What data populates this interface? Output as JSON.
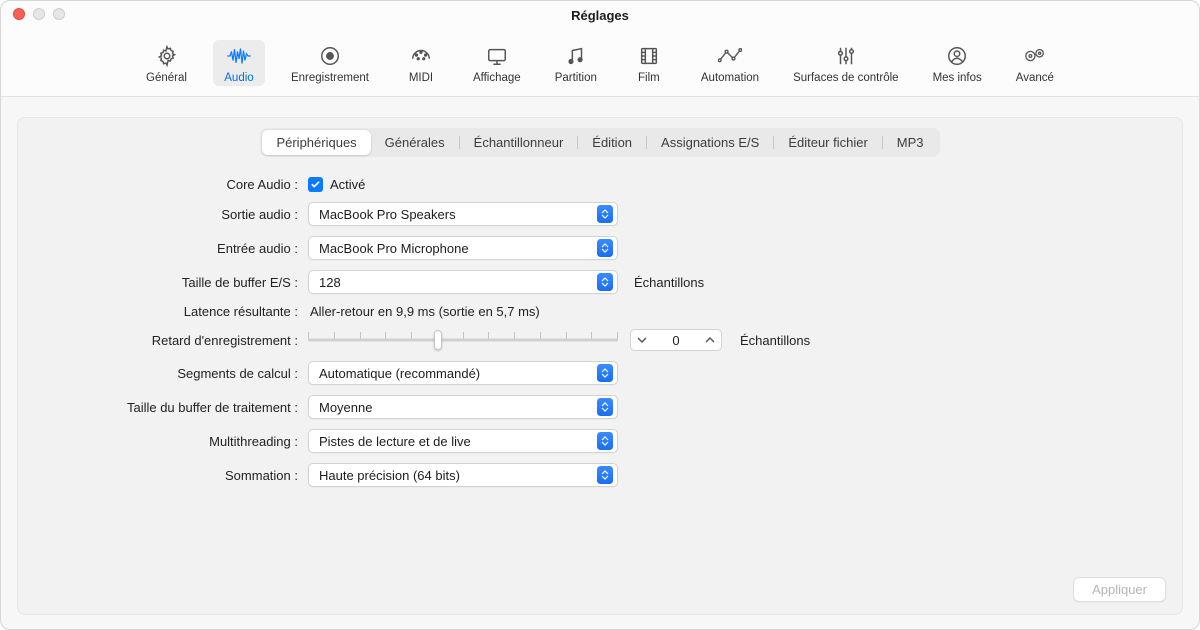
{
  "window": {
    "title": "Réglages"
  },
  "toolbar": {
    "items": [
      {
        "id": "general",
        "label": "Général"
      },
      {
        "id": "audio",
        "label": "Audio"
      },
      {
        "id": "recording",
        "label": "Enregistrement"
      },
      {
        "id": "midi",
        "label": "MIDI"
      },
      {
        "id": "display",
        "label": "Affichage"
      },
      {
        "id": "score",
        "label": "Partition"
      },
      {
        "id": "movie",
        "label": "Film"
      },
      {
        "id": "automation",
        "label": "Automation"
      },
      {
        "id": "controlsurfaces",
        "label": "Surfaces de contrôle"
      },
      {
        "id": "myinfo",
        "label": "Mes infos"
      },
      {
        "id": "advanced",
        "label": "Avancé"
      }
    ],
    "selected": "audio"
  },
  "tabs": {
    "items": [
      "Périphériques",
      "Générales",
      "Échantillonneur",
      "Édition",
      "Assignations E/S",
      "Éditeur fichier",
      "MP3"
    ],
    "active_index": 0
  },
  "form": {
    "core_audio": {
      "label": "Core Audio :",
      "value_label": "Activé",
      "checked": true
    },
    "output": {
      "label": "Sortie audio :",
      "value": "MacBook Pro Speakers"
    },
    "input": {
      "label": "Entrée audio :",
      "value": "MacBook Pro Microphone"
    },
    "buffer": {
      "label": "Taille de buffer E/S :",
      "value": "128",
      "unit": "Échantillons"
    },
    "latency": {
      "label": "Latence résultante :",
      "value": "Aller-retour en 9,9 ms (sortie en 5,7 ms)"
    },
    "rec_delay": {
      "label": "Retard d'enregistrement :",
      "value": "0",
      "unit": "Échantillons"
    },
    "process_threads": {
      "label": "Segments de calcul :",
      "value": "Automatique (recommandé)"
    },
    "process_buffer": {
      "label": "Taille du buffer de traitement :",
      "value": "Moyenne"
    },
    "multithreading": {
      "label": "Multithreading :",
      "value": "Pistes de lecture et de live"
    },
    "summing": {
      "label": "Sommation :",
      "value": "Haute précision (64 bits)"
    }
  },
  "apply_button": "Appliquer"
}
